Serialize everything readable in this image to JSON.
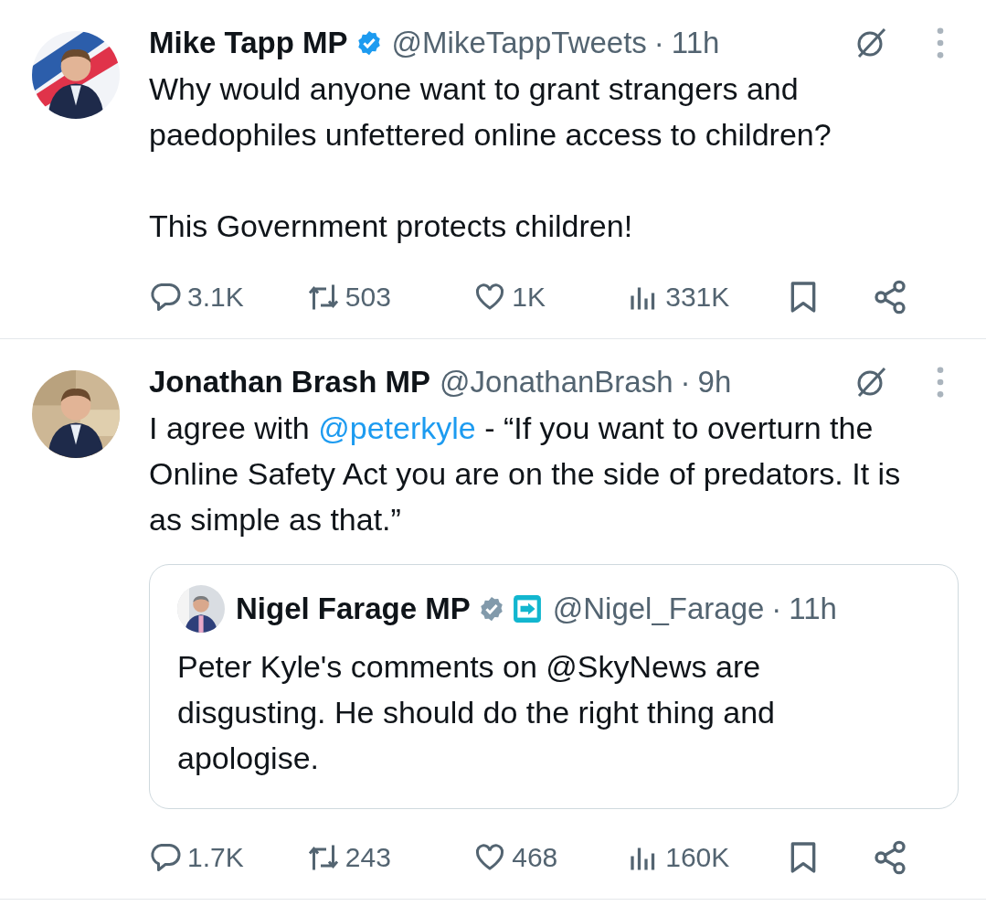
{
  "tweets": [
    {
      "author": {
        "name": "Mike Tapp MP",
        "verified": true,
        "color": "#1d9bf0",
        "affiliate": false,
        "handle": "@MikeTappTweets",
        "separator": "·",
        "time": "11h"
      },
      "paragraphs": [
        [
          {
            "kind": "text",
            "text": "Why would anyone want to grant strangers and paedophiles unfettered online access to children?"
          }
        ],
        [
          {
            "kind": "text",
            "text": "This Government protects children!"
          }
        ]
      ],
      "stats": {
        "replies": "3.1K",
        "reposts": "503",
        "likes": "1K",
        "views": "331K"
      }
    },
    {
      "author": {
        "name": "Jonathan Brash MP",
        "verified": false,
        "affiliate": false,
        "handle": "@JonathanBrash",
        "separator": "·",
        "time": "9h"
      },
      "paragraphs": [
        [
          {
            "kind": "text",
            "text": "I agree with "
          },
          {
            "kind": "mention",
            "text": "@peterkyle"
          },
          {
            "kind": "text",
            "text": " - “If you want to overturn the Online Safety Act you are on the side of predators. It is as simple as that.”"
          }
        ]
      ],
      "quote": {
        "author": {
          "name": "Nigel Farage MP",
          "verified": true,
          "color": "#829aab",
          "affiliate": true,
          "handle": "@Nigel_Farage",
          "separator": "·",
          "time": "11h"
        },
        "text": "Peter Kyle's comments on @SkyNews are disgusting. He should do the right thing and apologise."
      },
      "stats": {
        "replies": "1.7K",
        "reposts": "243",
        "likes": "468",
        "views": "160K"
      }
    }
  ]
}
